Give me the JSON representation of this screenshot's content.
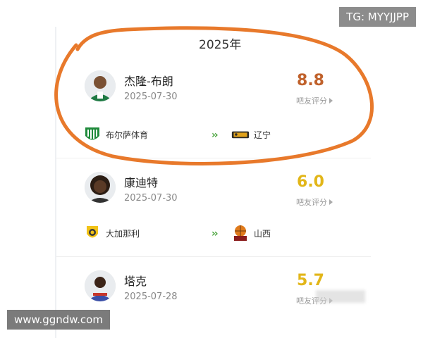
{
  "header": {
    "year": "2025年"
  },
  "players": [
    {
      "name": "杰隆-布朗",
      "date": "2025-07-30",
      "rating": "8.8",
      "rating_color": "#c0612b",
      "rating_caption": "吧友评分",
      "from_team": "布尔萨体育",
      "to_team": "辽宁",
      "from_logo": "bursaspor-logo-icon",
      "to_logo": "liaoning-logo-icon"
    },
    {
      "name": "康迪特",
      "date": "2025-07-30",
      "rating": "6.0",
      "rating_color": "#e2b619",
      "rating_caption": "吧友评分",
      "from_team": "大加那利",
      "to_team": "山西",
      "from_logo": "gran-canaria-logo-icon",
      "to_logo": "shanxi-logo-icon"
    },
    {
      "name": "塔克",
      "date": "2025-07-28",
      "rating": "5.7",
      "rating_color": "#e2b619",
      "rating_caption": "吧友评分"
    }
  ],
  "watermarks": {
    "tg": "TG: MYYJJPP",
    "url": "www.ggndw.com"
  },
  "annotation_color": "#e8792b"
}
